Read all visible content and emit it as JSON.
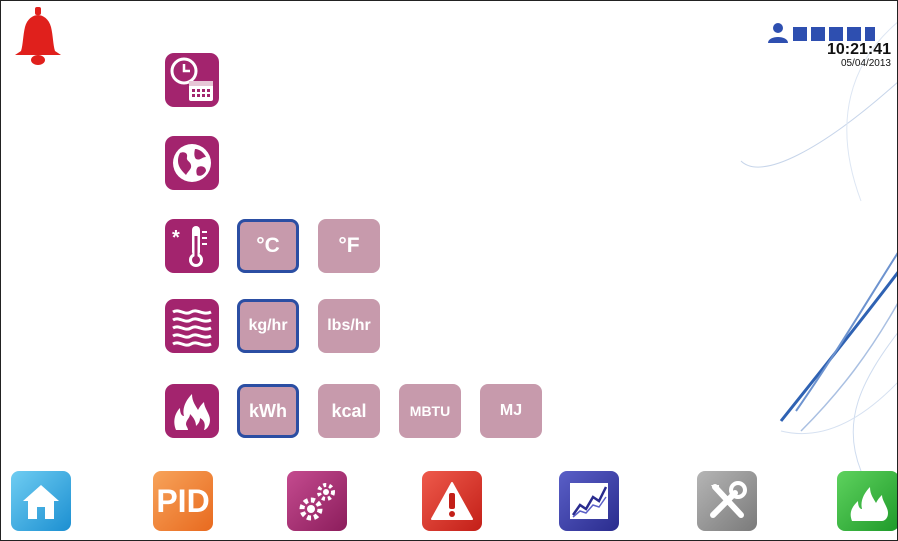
{
  "status": {
    "time": "10:21:41",
    "date": "05/04/2013"
  },
  "icons": {
    "alarm": "bell-icon",
    "user": "user-icon",
    "datetime": "clock-calendar-icon",
    "region": "globe-icon",
    "temperature": "thermometer-icon",
    "flow": "flow-waves-icon",
    "energy": "flame-icon"
  },
  "units": {
    "temperature": {
      "selected": "°C",
      "options": [
        "°C",
        "°F"
      ]
    },
    "flow": {
      "selected": "kg/hr",
      "options": [
        "kg/hr",
        "lbs/hr"
      ]
    },
    "energy": {
      "selected": "kWh",
      "options": [
        "kWh",
        "kcal",
        "MBTU",
        "MJ"
      ]
    }
  },
  "nav": {
    "home_icon": "home-icon",
    "pid_label": "PID",
    "settings_icon": "gears-icon",
    "alarms_icon": "warning-icon",
    "trends_icon": "chart-icon",
    "tools_icon": "tools-icon",
    "burner_icon": "burner-flame-icon"
  },
  "colors": {
    "category": "#a3246e",
    "option": "#c79aac",
    "selected_border": "#2b4ea3",
    "alarm": "#e0201c"
  }
}
